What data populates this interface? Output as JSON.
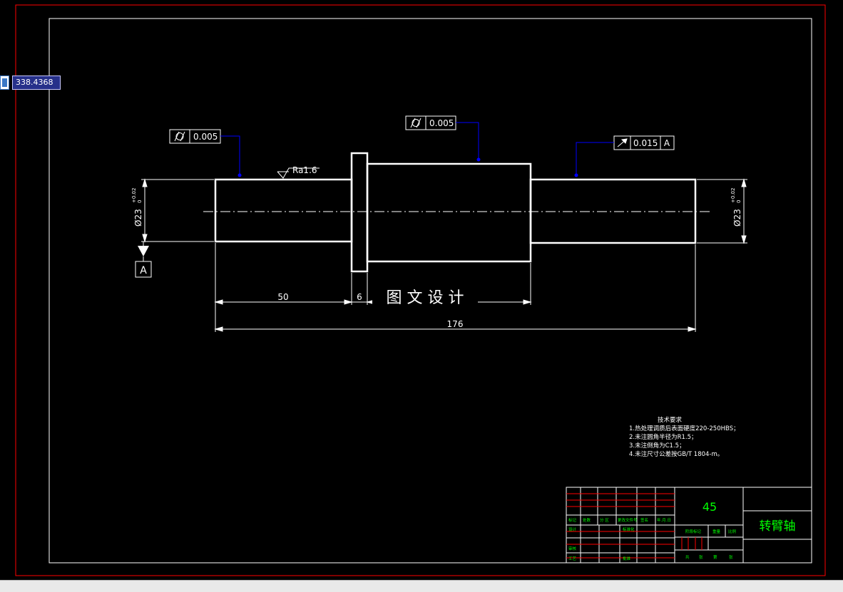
{
  "viewport": {
    "coordinate_input_value": "338.4368"
  },
  "drawing": {
    "geometric_tolerances": [
      {
        "symbol": "circularity",
        "value": "0.005"
      },
      {
        "symbol": "circularity",
        "value": "0.005"
      },
      {
        "symbol": "circular-runout",
        "value": "0.015",
        "datum": "A"
      }
    ],
    "surface_roughness": "Ra1.6",
    "datum_label": "A",
    "diameter_left": "Ø23",
    "diameter_right": "Ø23",
    "tolerance_upper": "+0.02",
    "tolerance_lower": "0",
    "dimensions": {
      "d50": "50",
      "d6": "6",
      "d176": "176"
    },
    "watermark": "图 文 设 计"
  },
  "technical_requirements": {
    "title": "技术要求",
    "items": [
      "1.热处理调质后表面硬度220-250HBS；",
      "2.未注圆角半径为R1.5；",
      "3.未注倒角为C1.5；",
      "4.未注尺寸公差按GB/T 1804-m。"
    ]
  },
  "title_block": {
    "material": "45",
    "part_name": "转臂轴",
    "headers": [
      "标记",
      "处数",
      "分 区",
      "更改文件号",
      "签名",
      "年.月.日"
    ],
    "row_labels": [
      "设计",
      "标准化",
      "审核",
      "工艺",
      "批准"
    ],
    "right_labels": [
      "阶段标记",
      "重量",
      "比例"
    ],
    "sheet_labels": [
      "共",
      "张",
      "第",
      "张"
    ]
  },
  "colors": {
    "background": "#000000",
    "outline": "#ffffff",
    "leader": "#0000ff",
    "border_outer": "#ff0000",
    "titleblock_lines": "#ffffff",
    "titleblock_red": "#ff0000",
    "titleblock_text": "#00ff00"
  }
}
